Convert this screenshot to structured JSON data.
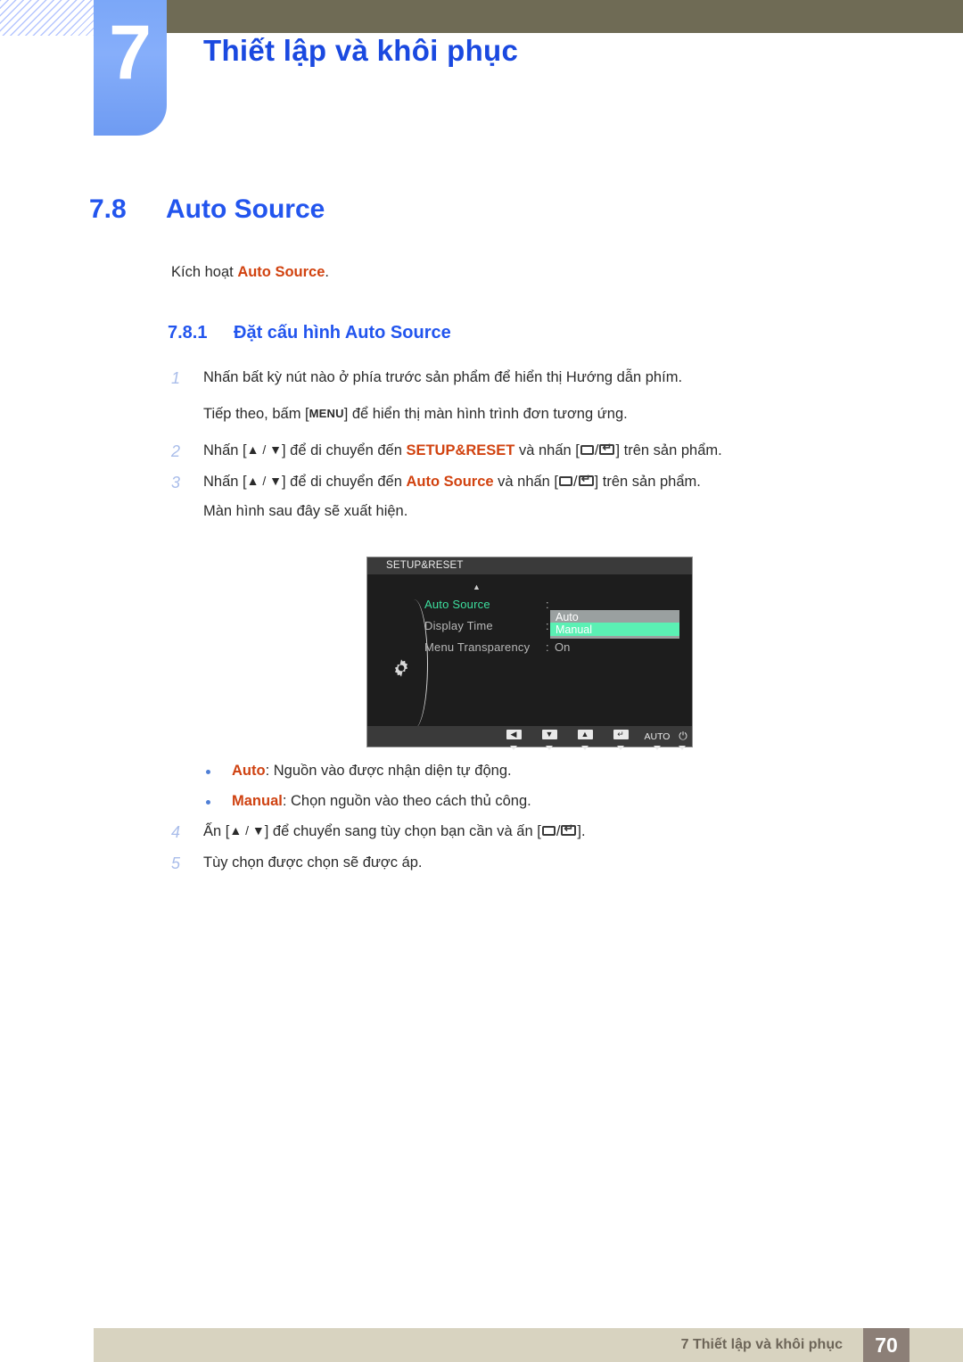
{
  "header": {
    "chapter_number": "7",
    "chapter_title": "Thiết lập và khôi phục",
    "olive_color": "#6f6b55",
    "badge_color": "#7ba7f8",
    "title_color": "#1a49e0"
  },
  "section": {
    "number": "7.8",
    "title": "Auto Source",
    "intro_prefix": "Kích hoạt ",
    "intro_keyword": "Auto Source",
    "intro_suffix": ".",
    "subsection_number": "7.8.1",
    "subsection_title": "Đặt cấu hình Auto Source"
  },
  "steps": [
    {
      "no": "1",
      "text": "Nhấn bất kỳ nút nào ở phía trước sản phẩm để hiển thị Hướng dẫn phím."
    },
    {
      "no": "2",
      "pre": "Nhấn [",
      "arrows": "▲ / ▼",
      "mid": "] để di chuyển đến ",
      "keyword": "SETUP&RESET",
      "mid2": " và nhấn [",
      "post": "] trên sản phẩm."
    },
    {
      "no": "3",
      "pre": "Nhấn [",
      "arrows": "▲ / ▼",
      "mid": "] để di chuyển đến ",
      "keyword": "Auto Source",
      "mid2": " và nhấn [",
      "post": "] trên sản phẩm."
    },
    {
      "no": "4",
      "pre": "Ấn [",
      "arrows": "▲ / ▼",
      "mid": "] để chuyển sang tùy chọn bạn cần và ấn [",
      "post": "]."
    },
    {
      "no": "5",
      "text": "Tùy chọn được chọn sẽ được áp."
    }
  ],
  "continuations": {
    "step1_next_pre": "Tiếp theo, bấm [",
    "step1_next_key": "MENU",
    "step1_next_post": "] để hiển thị màn hình trình đơn tương ứng.",
    "step3_after": "Màn hình sau đây sẽ xuất hiện."
  },
  "osd": {
    "title": "SETUP&RESET",
    "up_arrow": "▲",
    "rows": [
      {
        "label": "Auto Source",
        "colon": ":",
        "value": "",
        "active": true
      },
      {
        "label": "Display Time",
        "colon": ":",
        "value": "",
        "active": false
      },
      {
        "label": "Menu Transparency",
        "colon": ":",
        "value": "On",
        "active": false
      }
    ],
    "dropdown": {
      "options": [
        "Auto",
        "Manual"
      ],
      "selected": "Manual",
      "bg_color": "#9aa0a0",
      "highlight_color": "#5bf0b4"
    },
    "footer_buttons": [
      {
        "name": "left",
        "glyph": "◀"
      },
      {
        "name": "down",
        "glyph": "▼"
      },
      {
        "name": "up",
        "glyph": "▲"
      },
      {
        "name": "enter",
        "glyph": "↵"
      },
      {
        "name": "auto",
        "glyph": "AUTO"
      },
      {
        "name": "power",
        "glyph": "⏻"
      }
    ],
    "active_label_color": "#3ddf9e"
  },
  "bullets": [
    {
      "keyword": "Auto",
      "text": ": Nguồn vào được nhận diện tự động."
    },
    {
      "keyword": "Manual",
      "text": ": Chọn nguồn vào theo cách thủ công."
    }
  ],
  "footer": {
    "text": "7 Thiết lập và khôi phục",
    "page": "70",
    "bar_color": "#d8d3c0",
    "page_box_color": "#8c7f77"
  }
}
